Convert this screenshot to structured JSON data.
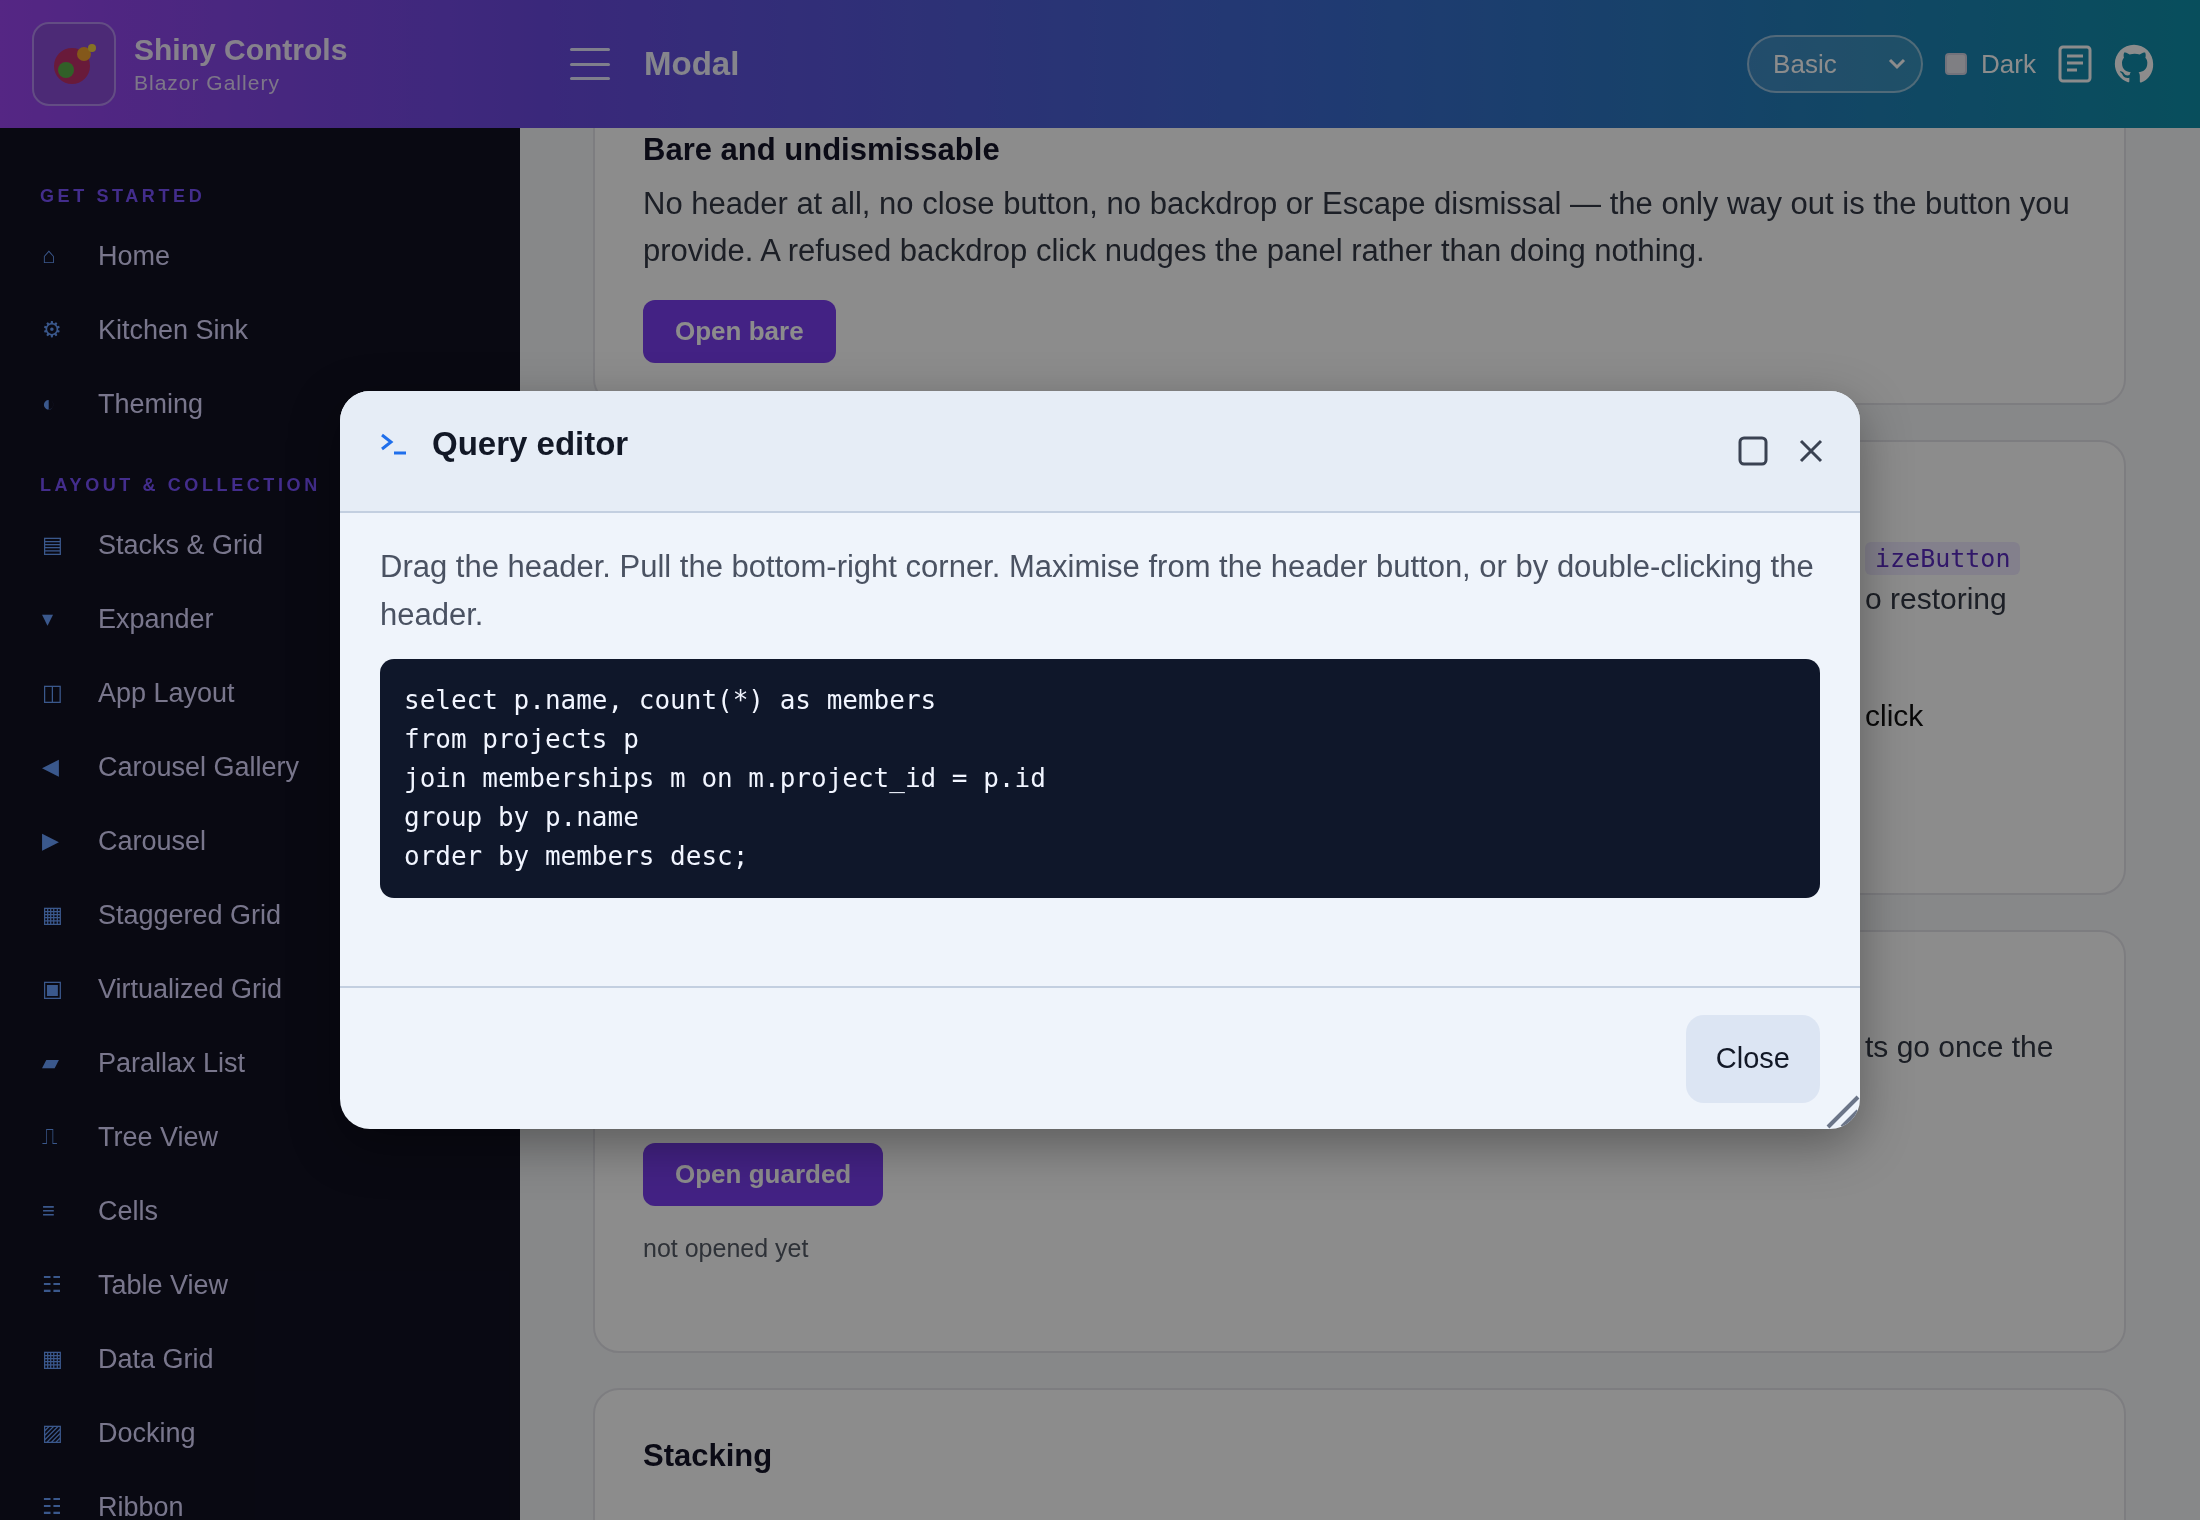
{
  "brand": {
    "title": "Shiny Controls",
    "subtitle": "Blazor Gallery"
  },
  "topbar": {
    "page_title": "Modal",
    "variant_select": {
      "value": "Basic"
    },
    "dark_toggle": {
      "label": "Dark",
      "checked": false
    }
  },
  "sidebar": {
    "sections": [
      {
        "title": "GET STARTED",
        "items": [
          {
            "icon": "⌂",
            "label": "Home",
            "selected": false
          },
          {
            "icon": "⚙",
            "label": "Kitchen Sink",
            "selected": false
          },
          {
            "icon": "◐",
            "label": "Theming",
            "selected": false
          }
        ]
      },
      {
        "title": "LAYOUT & COLLECTION",
        "items": [
          {
            "icon": "▤",
            "label": "Stacks & Grid",
            "selected": false
          },
          {
            "icon": "▾",
            "label": "Expander",
            "selected": false
          },
          {
            "icon": "◫",
            "label": "App Layout",
            "selected": false
          },
          {
            "icon": "◀",
            "label": "Carousel Gallery",
            "selected": false
          },
          {
            "icon": "▶",
            "label": "Carousel",
            "selected": false
          },
          {
            "icon": "▦",
            "label": "Staggered Grid",
            "selected": false
          },
          {
            "icon": "▣",
            "label": "Virtualized Grid",
            "selected": false
          },
          {
            "icon": "▰",
            "label": "Parallax List",
            "selected": false
          },
          {
            "icon": "⎍",
            "label": "Tree View",
            "selected": false
          },
          {
            "icon": "≡",
            "label": "Cells",
            "selected": false
          },
          {
            "icon": "☷",
            "label": "Table View",
            "selected": false
          },
          {
            "icon": "▦",
            "label": "Data Grid",
            "selected": false
          },
          {
            "icon": "▨",
            "label": "Docking",
            "selected": false
          },
          {
            "icon": "☷",
            "label": "Ribbon",
            "selected": false
          }
        ]
      }
    ]
  },
  "cards": [
    {
      "kind": "open",
      "heading": "Bare and undismissable",
      "body": "No header at all, no close button, no backdrop or Escape dismissal — the only way out is the button you provide. A refused backdrop click nudges the panel rather than doing nothing.",
      "button": "Open bare"
    },
    {
      "kind": "covered",
      "fragments": [
        {
          "kind": "code",
          "text": "izeButton"
        },
        {
          "kind": "text",
          "text": "o restoring"
        },
        {
          "kind": "note",
          "text": "click"
        }
      ]
    },
    {
      "kind": "covered",
      "fragments": [
        {
          "kind": "text",
          "text": "ts go once the"
        }
      ],
      "button": "Open guarded",
      "status": "not opened yet"
    },
    {
      "kind": "open",
      "heading": "Stacking"
    }
  ],
  "modal": {
    "title": "Query editor",
    "body": "Drag the header. Pull the bottom-right corner. Maximise from the header button, or by double-clicking the header.",
    "code": [
      "select p.name, count(*) as members",
      "from projects p",
      "join memberships m on m.project_id = p.id",
      "group by p.name",
      "order by members desc;"
    ],
    "footer_button": "Close"
  }
}
